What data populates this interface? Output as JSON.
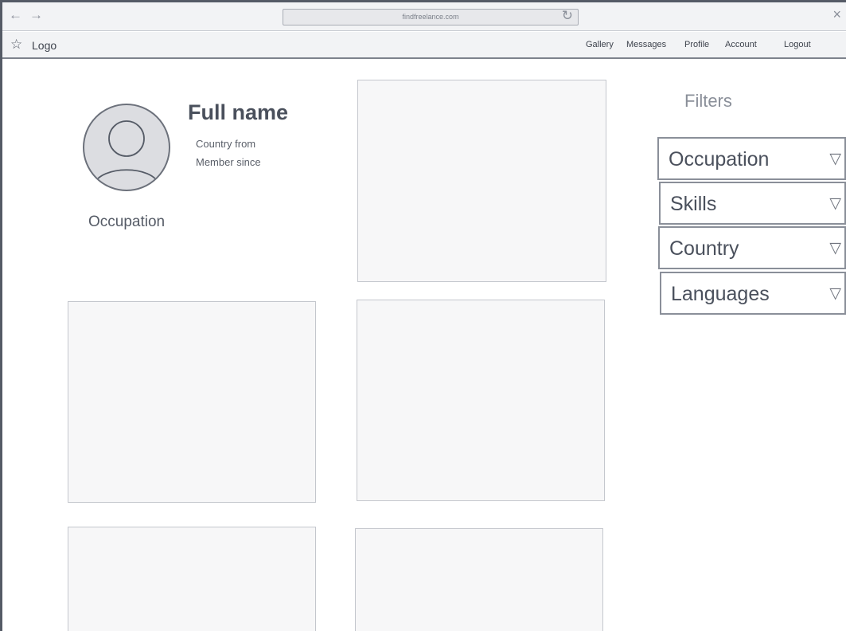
{
  "browser": {
    "url": "findfreelance.com",
    "back_glyph": "←",
    "forward_glyph": "→",
    "reload_glyph": "↻",
    "close_glyph": "×"
  },
  "navbar": {
    "logo_glyph": "☆",
    "logo": "Logo",
    "links": [
      "Gallery",
      "Messages",
      "Profile",
      "Account",
      "Logout"
    ]
  },
  "profile": {
    "full_name": "Full name",
    "country_from": "Country from",
    "member_since": "Member since",
    "occupation": "Occupation"
  },
  "filters": {
    "title": "Filters",
    "arrow_glyph": "▽",
    "items": [
      "Occupation",
      "Skills",
      "Country",
      "Languages"
    ]
  },
  "colors": {
    "frame": "#555b66",
    "chrome_bg": "#f2f3f5",
    "card_bg": "#f7f7f8",
    "text": "#4a505c"
  }
}
